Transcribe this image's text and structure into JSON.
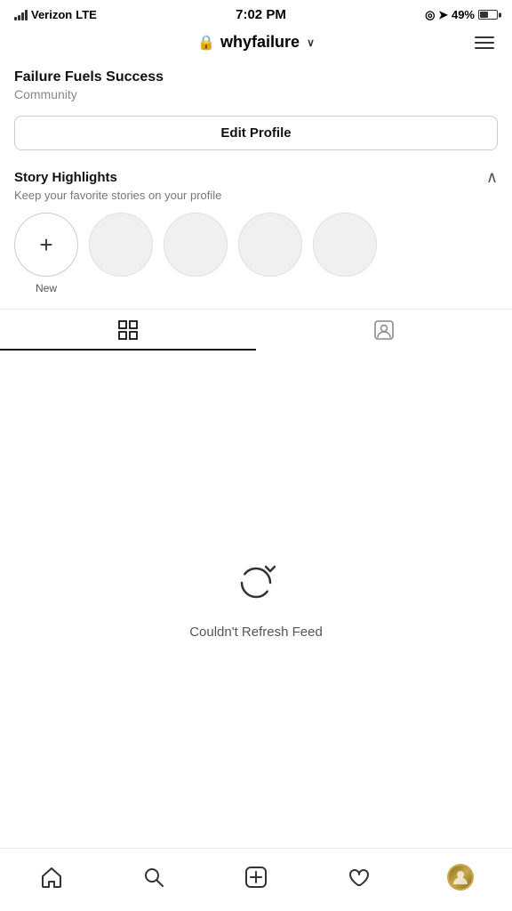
{
  "status": {
    "carrier": "Verizon",
    "network": "LTE",
    "time": "7:02 PM",
    "battery": "49%"
  },
  "header": {
    "username": "whyfailure",
    "lock_icon": "🔒",
    "menu_label": "Menu"
  },
  "profile": {
    "name": "Failure Fuels Success",
    "category": "Community"
  },
  "edit_profile_btn": "Edit Profile",
  "story_highlights": {
    "title": "Story Highlights",
    "subtitle": "Keep your favorite stories on your profile",
    "new_label": "New",
    "items": [
      {
        "id": 1,
        "empty": true
      },
      {
        "id": 2,
        "empty": true
      },
      {
        "id": 3,
        "empty": true
      },
      {
        "id": 4,
        "empty": true
      }
    ]
  },
  "tabs": {
    "grid_label": "Grid",
    "tagged_label": "Tagged"
  },
  "content": {
    "error_text": "Couldn't Refresh Feed"
  },
  "bottom_nav": {
    "home": "Home",
    "search": "Search",
    "add": "Add",
    "heart": "Activity",
    "profile": "Profile"
  }
}
